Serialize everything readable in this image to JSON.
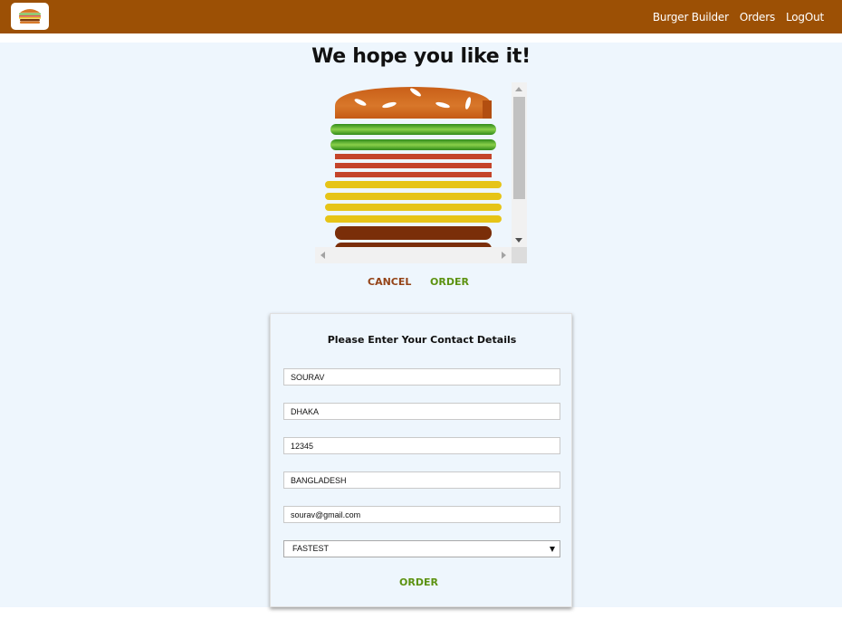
{
  "toolbar": {
    "logo_icon": "burger-logo-icon",
    "background": "#9c5005",
    "nav": [
      {
        "label": "Burger Builder"
      },
      {
        "label": "Orders"
      },
      {
        "label": "LogOut"
      }
    ]
  },
  "checkout": {
    "title": "We hope you like it!",
    "burger_layers": [
      "bread-top",
      "salad",
      "salad",
      "bacon",
      "bacon",
      "bacon",
      "cheese",
      "cheese",
      "cheese",
      "cheese",
      "meat",
      "meat"
    ],
    "cancel_label": "CANCEL",
    "order_label": "ORDER"
  },
  "contact": {
    "title": "Please Enter Your Contact Details",
    "fields": [
      {
        "value": "SOURAV"
      },
      {
        "value": "DHAKA"
      },
      {
        "value": "12345"
      },
      {
        "value": "BANGLADESH"
      },
      {
        "value": "sourav@gmail.com"
      }
    ],
    "delivery": {
      "selected": "FASTEST"
    },
    "order_label": "ORDER"
  },
  "colors": {
    "accent_cancel": "#944317",
    "accent_success": "#5c9210",
    "background": "#eef6fd"
  }
}
